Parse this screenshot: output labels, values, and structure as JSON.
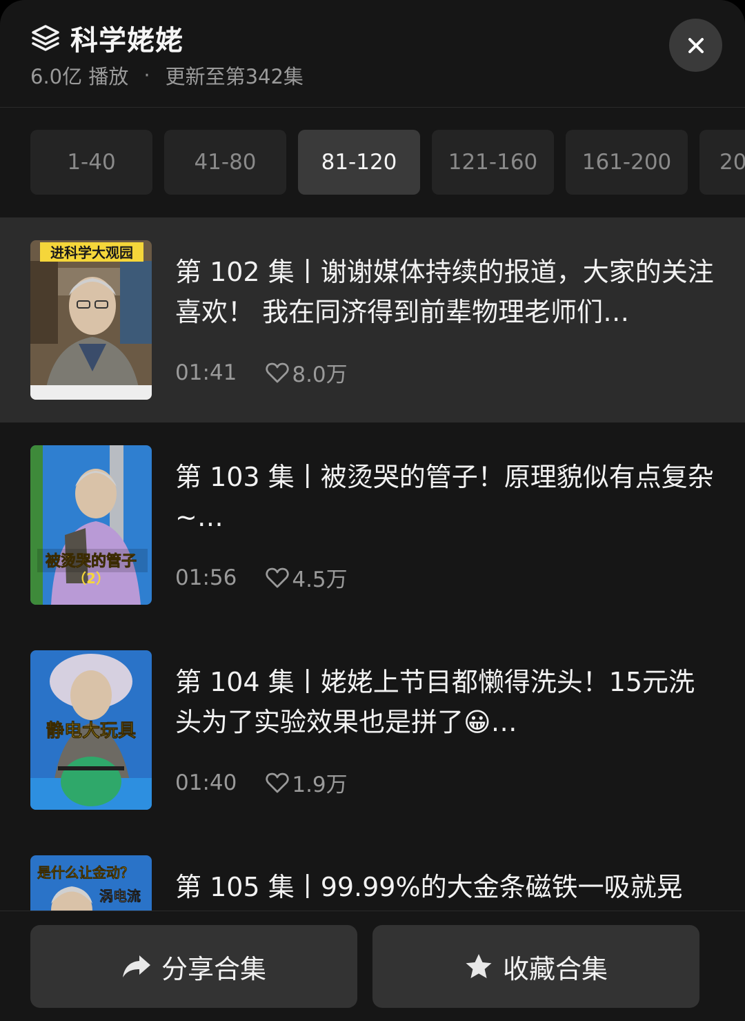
{
  "header": {
    "title": "科学姥姥",
    "plays": "6.0亿 播放",
    "separator": "·",
    "update": "更新至第342集"
  },
  "tabs": [
    {
      "label": "1-40",
      "active": false
    },
    {
      "label": "41-80",
      "active": false
    },
    {
      "label": "81-120",
      "active": true
    },
    {
      "label": "121-160",
      "active": false
    },
    {
      "label": "161-200",
      "active": false
    },
    {
      "label": "20",
      "active": false
    }
  ],
  "episodes": [
    {
      "title": "第 102 集丨谢谢媒体持续的报道，大家的关注喜欢！ 我在同济得到前辈物理老师们…",
      "duration": "01:41",
      "likes": "8.0万",
      "thumb_caption": "进科学大观园",
      "selected": true
    },
    {
      "title": "第 103 集丨被烫哭的管子！原理貌似有点复杂~…",
      "duration": "01:56",
      "likes": "4.5万",
      "thumb_caption": "被烫哭的管子",
      "thumb_caption2": "（2）",
      "selected": false
    },
    {
      "title": "第 104 集丨姥姥上节目都懒得洗头！15元洗头为了实验效果也是拼了😀…",
      "duration": "01:40",
      "likes": "1.9万",
      "thumb_caption": "静电大玩具",
      "selected": false
    },
    {
      "title": "第 105 集丨99.99%的大金条磁铁一吸就晃",
      "thumb_caption": "是什么让金动？",
      "thumb_caption2": "涡电流",
      "selected": false
    }
  ],
  "actions": {
    "share": "分享合集",
    "favorite": "收藏合集"
  },
  "icons": {
    "title": "stack-icon",
    "close": "close-icon",
    "like": "heart-outline-icon",
    "share": "share-arrow-icon",
    "favorite": "star-icon"
  }
}
